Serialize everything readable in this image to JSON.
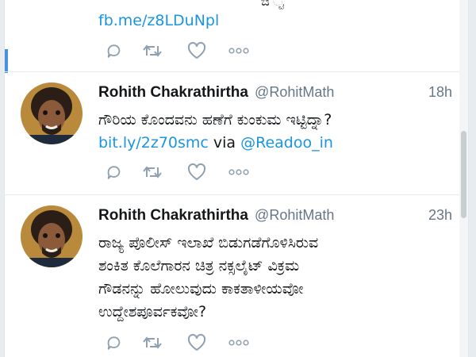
{
  "tweets": [
    {
      "lines": [
        [
          {
            "kind": "txt",
            "text": "ಔ ್ಟ"
          }
        ],
        [
          {
            "kind": "link",
            "text": "fb.me/z8LDuNpl"
          }
        ]
      ],
      "actions": [
        "reply-icon",
        "retweet-icon",
        "like-icon",
        "more-icon"
      ]
    },
    {
      "name": "Rohith Chakrathirtha",
      "handle": "@RohitMath",
      "time": "18h",
      "lines": [
        [
          {
            "kind": "txt",
            "text": "ಗೌರಿಯ ಕೊಂದವನು ಹಣೆಗೆ ಕುಂಕುಮ ಇಟ್ಟಿದ್ನಾ?"
          }
        ],
        [
          {
            "kind": "link",
            "text": "bit.ly/2z70smc"
          },
          {
            "kind": "txt",
            "text": " via "
          },
          {
            "kind": "link",
            "text": "@Readoo_in"
          }
        ]
      ],
      "actions": [
        "reply-icon",
        "retweet-icon",
        "like-icon",
        "more-icon"
      ]
    },
    {
      "name": "Rohith Chakrathirtha",
      "handle": "@RohitMath",
      "time": "23h",
      "lines": [
        [
          {
            "kind": "txt",
            "text": "ರಾಜ್ಯ ಪೊಲೀಸ್ ಇಲಾಖೆ ಬಿಡುಗಡೆಗೊಳಿಸಿರುವ"
          }
        ],
        [
          {
            "kind": "txt",
            "text": "ಶಂಕಿತ ಕೊಲೆಗಾರನ ಚಿತ್ರ ನಕ್ಸಲೈಟ್ ವಿಕ್ರಮ"
          }
        ],
        [
          {
            "kind": "txt",
            "text": "ಗೌಡನನ್ನು ಹೋಲುವುದು ಕಾಕತಾಳೀಯವೋ"
          }
        ],
        [
          {
            "kind": "txt",
            "text": "ಉದ್ದೇಶಪೂರ್ವಕವೋ?"
          }
        ]
      ],
      "actions": [
        "reply-icon",
        "retweet-icon",
        "like-icon",
        "more-icon"
      ]
    }
  ],
  "colors": {
    "link": "#1b95e0",
    "meta": "#657786",
    "icon": "#8fa1b0",
    "accent": "#4a90e2"
  }
}
